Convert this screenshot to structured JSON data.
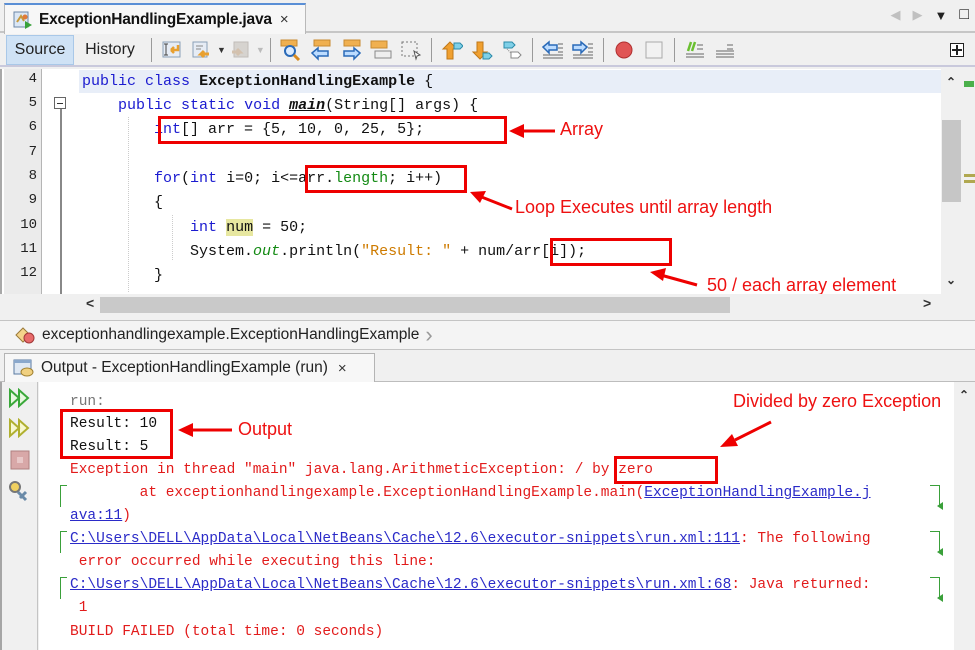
{
  "editor_tab": {
    "title": "ExceptionHandlingExample.java",
    "close": "×"
  },
  "tab_controls": {
    "prev": "◀",
    "next": "▶",
    "menu": "▼",
    "maximize": "□"
  },
  "toolbar": {
    "source_label": "Source",
    "history_label": "History",
    "icons": [
      "last-edit-icon",
      "previous-bookmark-icon",
      "next-bookmark-icon",
      "find-icon",
      "find-previous-icon",
      "find-next-icon",
      "toggle-highlight-icon",
      "select-rectangle-icon",
      "shift-line-up-icon",
      "shift-line-down-icon",
      "toggle-bookmark-icon",
      "shift-left-icon",
      "shift-right-icon",
      "start-macro-icon",
      "stop-macro-icon",
      "comment-icon",
      "uncomment-icon"
    ]
  },
  "code": {
    "lines": [
      {
        "n": "4",
        "text": "public class ExceptionHandlingExample {"
      },
      {
        "n": "5",
        "text": "    public static void main(String[] args) {"
      },
      {
        "n": "6",
        "text": "        int[] arr = {5, 10, 0, 25, 5};"
      },
      {
        "n": "7",
        "text": ""
      },
      {
        "n": "8",
        "text": "        for(int i=0; i<=arr.length; i++)"
      },
      {
        "n": "9",
        "text": "        {"
      },
      {
        "n": "10",
        "text": "            int num = 50;"
      },
      {
        "n": "11",
        "text": "            System.out.println(\"Result: \" + num/arr[i]);"
      },
      {
        "n": "12",
        "text": "        }"
      }
    ],
    "tokens": {
      "public": "public",
      "class": "class",
      "classname": "ExceptionHandlingExample",
      "brace_open": " {",
      "static": "static",
      "void": "void",
      "main": "main",
      "main_args": "(String[] args) {",
      "arr_decl_int": "int",
      "arr_decl_rest": "[] arr = {5, 10, 0, 25, 5};",
      "for": "for",
      "for_paren": "(",
      "for_int": "int",
      "for_init": " i=0; ",
      "cond_pre": "i<=arr.",
      "length": "length",
      "cond_semi": ";",
      "for_inc": " i++)",
      "open_brace": "{",
      "num_int": "int",
      "num_var": "num",
      "num_rest": " = 50;",
      "system": "System.",
      "out": "out",
      "println": ".println(",
      "str_result": "\"Result: \"",
      "plus": " + ",
      "div": "num/arr[i]",
      "close_call": ");",
      "close_brace": "}"
    }
  },
  "annotations": {
    "array": "Array",
    "loop": "Loop Executes until array length",
    "division": "50 / each array element",
    "output": "Output",
    "divzero": "Divided by zero Exception"
  },
  "scroll": {
    "left": "<",
    "right": ">",
    "up": "^",
    "down": "v"
  },
  "breadcrumb": {
    "path": "exceptionhandlingexample.ExceptionHandlingExample",
    "chevron": "›"
  },
  "output_tab": {
    "title": "Output - ExceptionHandlingExample (run)",
    "close": "×"
  },
  "output": {
    "run": "run:",
    "result1": "Result: 10",
    "result2": "Result: 5",
    "exception_pre": "Exception in thread \"main\" java.lang.ArithmeticException: ",
    "exception_msg": "/ by zero",
    "at_pre": "        at exceptionhandlingexample.ExceptionHandlingExample.main(",
    "at_link1": "ExceptionHandlingExample.j",
    "at_link2": "ava:11",
    "at_close": ")",
    "path1": "C:\\Users\\DELL\\AppData\\Local\\NetBeans\\Cache\\12.6\\executor-snippets\\run.xml:111",
    "path1_tail": ": The following",
    "path1_cont": " error occurred while executing this line:",
    "path2": "C:\\Users\\DELL\\AppData\\Local\\NetBeans\\Cache\\12.6\\executor-snippets\\run.xml:68",
    "path2_tail": ": Java returned:",
    "path2_cont": " 1",
    "build": "BUILD FAILED (total time: 0 seconds)"
  },
  "output_side": [
    "rerun-icon",
    "rerun-with-params-icon",
    "stop-icon",
    "settings-icon"
  ]
}
